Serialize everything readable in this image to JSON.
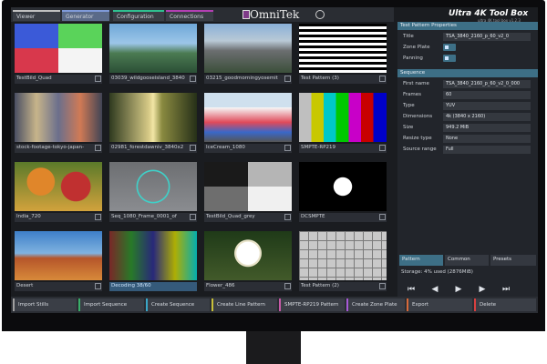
{
  "app": {
    "tabs": [
      "Viewer",
      "Generator",
      "Configuration",
      "Connections"
    ],
    "brand": "OmniTek",
    "title": "Ultra 4K Tool Box",
    "subtitle": "ultra 4K tool box v1.2.3"
  },
  "grid": {
    "items": [
      {
        "label": "TestBild_Quad"
      },
      {
        "label": "03039_wildgooseisland_3840"
      },
      {
        "label": "03215_goodmorningyosemit"
      },
      {
        "label": "Test Pattern (3)"
      },
      {
        "label": "stock-footage-tokyo-japan-"
      },
      {
        "label": "02981_forestdawniv_3840x2"
      },
      {
        "label": "IceCream_1080"
      },
      {
        "label": "SMPTE-RP219"
      },
      {
        "label": "India_720"
      },
      {
        "label": "Seq_1080_Frame_0001_of"
      },
      {
        "label": "TestBild_Quad_grey"
      },
      {
        "label": "DCSMPTE"
      },
      {
        "label": "Desert"
      },
      {
        "label": "Decoding 38/60"
      },
      {
        "label": "Flower_486"
      },
      {
        "label": "Test Pattern (2)"
      }
    ]
  },
  "panel": {
    "header": "Test Pattern Properties",
    "title_label": "Title",
    "title_value": "TSA_3840_2160_p_60_v2_0",
    "zone_plate_label": "Zone Plate",
    "panning_label": "Panning",
    "sequence_header": "Sequence",
    "rows": [
      {
        "label": "First name",
        "value": "TSA_3840_2160_p_60_v2_0_000"
      },
      {
        "label": "Frames",
        "value": "60"
      },
      {
        "label": "Type",
        "value": "YUV"
      },
      {
        "label": "Dimensions",
        "value": "4k (3840 x 2160)"
      },
      {
        "label": "Size",
        "value": "949.2 MiB"
      },
      {
        "label": "Resize type",
        "value": "None"
      },
      {
        "label": "Source range",
        "value": "Full"
      }
    ],
    "tabs": [
      "Pattern",
      "Common",
      "Presets"
    ],
    "storage": "Storage: 4% used (2876MiB)"
  },
  "bottom": {
    "buttons": [
      "Import Stills",
      "Import Sequence",
      "Create Sequence",
      "Create Line Pattern",
      "SMPTE-RP219 Pattern",
      "Create Zone Plate",
      "Export",
      "Delete"
    ]
  },
  "colors": {
    "accent": "#3d6f86",
    "bg": "#1a1c20"
  }
}
